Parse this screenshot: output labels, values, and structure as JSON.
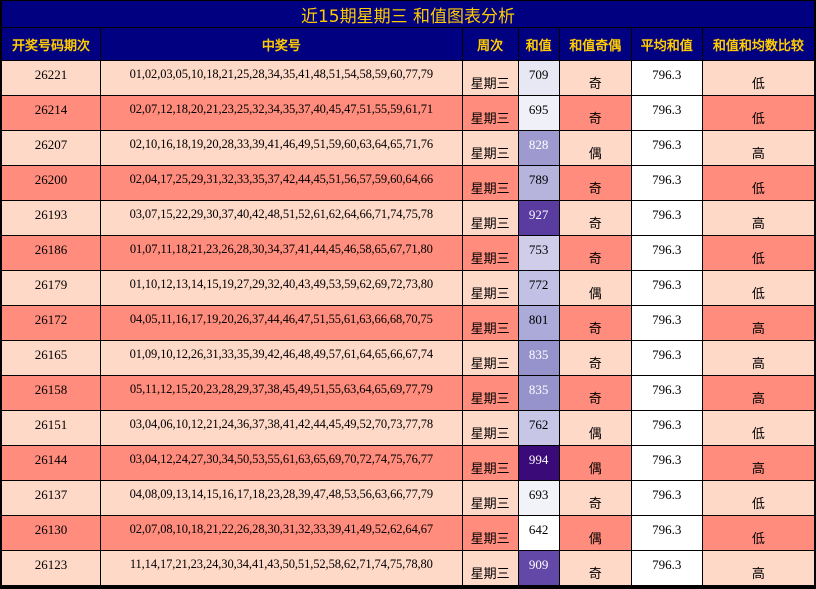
{
  "title": "近15期星期三 和值图表分析",
  "headers": {
    "issue": "开奖号码期次",
    "numbers": "中奖号",
    "weekday": "周次",
    "sum": "和值",
    "odd_even": "和值奇偶",
    "avg": "平均和值",
    "compare": "和值和均数比较"
  },
  "colors": {
    "header_bg": "#000080",
    "header_text": "#ffcc00",
    "row_light": "#ffd9c8",
    "row_dark": "#ff8c7c",
    "border": "#000000"
  },
  "rows": [
    {
      "issue": "26221",
      "numbers": "01,02,03,05,10,18,21,25,28,34,35,41,48,51,54,58,59,60,77,79",
      "weekday": "星期三",
      "sum": "709",
      "odd_even": "奇",
      "avg": "796.3",
      "compare": "低",
      "sum_bg": "#e8e8f4",
      "sum_fg": "#000000"
    },
    {
      "issue": "26214",
      "numbers": "02,07,12,18,20,21,23,25,32,34,35,37,40,45,47,51,55,59,61,71",
      "weekday": "星期三",
      "sum": "695",
      "odd_even": "奇",
      "avg": "796.3",
      "compare": "低",
      "sum_bg": "#f0f0f8",
      "sum_fg": "#000000"
    },
    {
      "issue": "26207",
      "numbers": "02,10,16,18,19,20,28,33,39,41,46,49,51,59,60,63,64,65,71,76",
      "weekday": "星期三",
      "sum": "828",
      "odd_even": "偶",
      "avg": "796.3",
      "compare": "高",
      "sum_bg": "#9e9ad0",
      "sum_fg": "#ffffff"
    },
    {
      "issue": "26200",
      "numbers": "02,04,17,25,29,31,32,33,35,37,42,44,45,51,56,57,59,60,64,66",
      "weekday": "星期三",
      "sum": "789",
      "odd_even": "奇",
      "avg": "796.3",
      "compare": "低",
      "sum_bg": "#b6b3dd",
      "sum_fg": "#000000"
    },
    {
      "issue": "26193",
      "numbers": "03,07,15,22,29,30,37,40,42,48,51,52,61,62,64,66,71,74,75,78",
      "weekday": "星期三",
      "sum": "927",
      "odd_even": "奇",
      "avg": "796.3",
      "compare": "高",
      "sum_bg": "#5a3ca0",
      "sum_fg": "#ffffff"
    },
    {
      "issue": "26186",
      "numbers": "01,07,11,18,21,23,26,28,30,34,37,41,44,45,46,58,65,67,71,80",
      "weekday": "星期三",
      "sum": "753",
      "odd_even": "奇",
      "avg": "796.3",
      "compare": "低",
      "sum_bg": "#cfcdea",
      "sum_fg": "#000000"
    },
    {
      "issue": "26179",
      "numbers": "01,10,12,13,14,15,19,27,29,32,40,43,49,53,59,62,69,72,73,80",
      "weekday": "星期三",
      "sum": "772",
      "odd_even": "偶",
      "avg": "796.3",
      "compare": "低",
      "sum_bg": "#c2c0e4",
      "sum_fg": "#000000"
    },
    {
      "issue": "26172",
      "numbers": "04,05,11,16,17,19,20,26,37,44,46,47,51,55,61,63,66,68,70,75",
      "weekday": "星期三",
      "sum": "801",
      "odd_even": "奇",
      "avg": "796.3",
      "compare": "高",
      "sum_bg": "#acaad8",
      "sum_fg": "#000000"
    },
    {
      "issue": "26165",
      "numbers": "01,09,10,12,26,31,33,35,39,42,46,48,49,57,61,64,65,66,67,74",
      "weekday": "星期三",
      "sum": "835",
      "odd_even": "奇",
      "avg": "796.3",
      "compare": "高",
      "sum_bg": "#9692cc",
      "sum_fg": "#ffffff"
    },
    {
      "issue": "26158",
      "numbers": "05,11,12,15,20,23,28,29,37,38,45,49,51,55,63,64,65,69,77,79",
      "weekday": "星期三",
      "sum": "835",
      "odd_even": "奇",
      "avg": "796.3",
      "compare": "高",
      "sum_bg": "#9692cc",
      "sum_fg": "#ffffff"
    },
    {
      "issue": "26151",
      "numbers": "03,04,06,10,12,21,24,36,37,38,41,42,44,45,49,52,70,73,77,78",
      "weekday": "星期三",
      "sum": "762",
      "odd_even": "偶",
      "avg": "796.3",
      "compare": "低",
      "sum_bg": "#c8c6e7",
      "sum_fg": "#000000"
    },
    {
      "issue": "26144",
      "numbers": "03,04,12,24,27,30,34,50,53,55,61,63,65,69,70,72,74,75,76,77",
      "weekday": "星期三",
      "sum": "994",
      "odd_even": "偶",
      "avg": "796.3",
      "compare": "高",
      "sum_bg": "#3a0a78",
      "sum_fg": "#ffffff"
    },
    {
      "issue": "26137",
      "numbers": "04,08,09,13,14,15,16,17,18,23,28,39,47,48,53,56,63,66,77,79",
      "weekday": "星期三",
      "sum": "693",
      "odd_even": "奇",
      "avg": "796.3",
      "compare": "低",
      "sum_bg": "#f2f2f9",
      "sum_fg": "#000000"
    },
    {
      "issue": "26130",
      "numbers": "02,07,08,10,18,21,22,26,28,30,31,32,33,39,41,49,52,62,64,67",
      "weekday": "星期三",
      "sum": "642",
      "odd_even": "偶",
      "avg": "796.3",
      "compare": "低",
      "sum_bg": "#ffffff",
      "sum_fg": "#000000"
    },
    {
      "issue": "26123",
      "numbers": "11,14,17,21,23,24,30,34,41,43,50,51,52,58,62,71,74,75,78,80",
      "weekday": "星期三",
      "sum": "909",
      "odd_even": "奇",
      "avg": "796.3",
      "compare": "高",
      "sum_bg": "#6448a8",
      "sum_fg": "#ffffff"
    }
  ]
}
